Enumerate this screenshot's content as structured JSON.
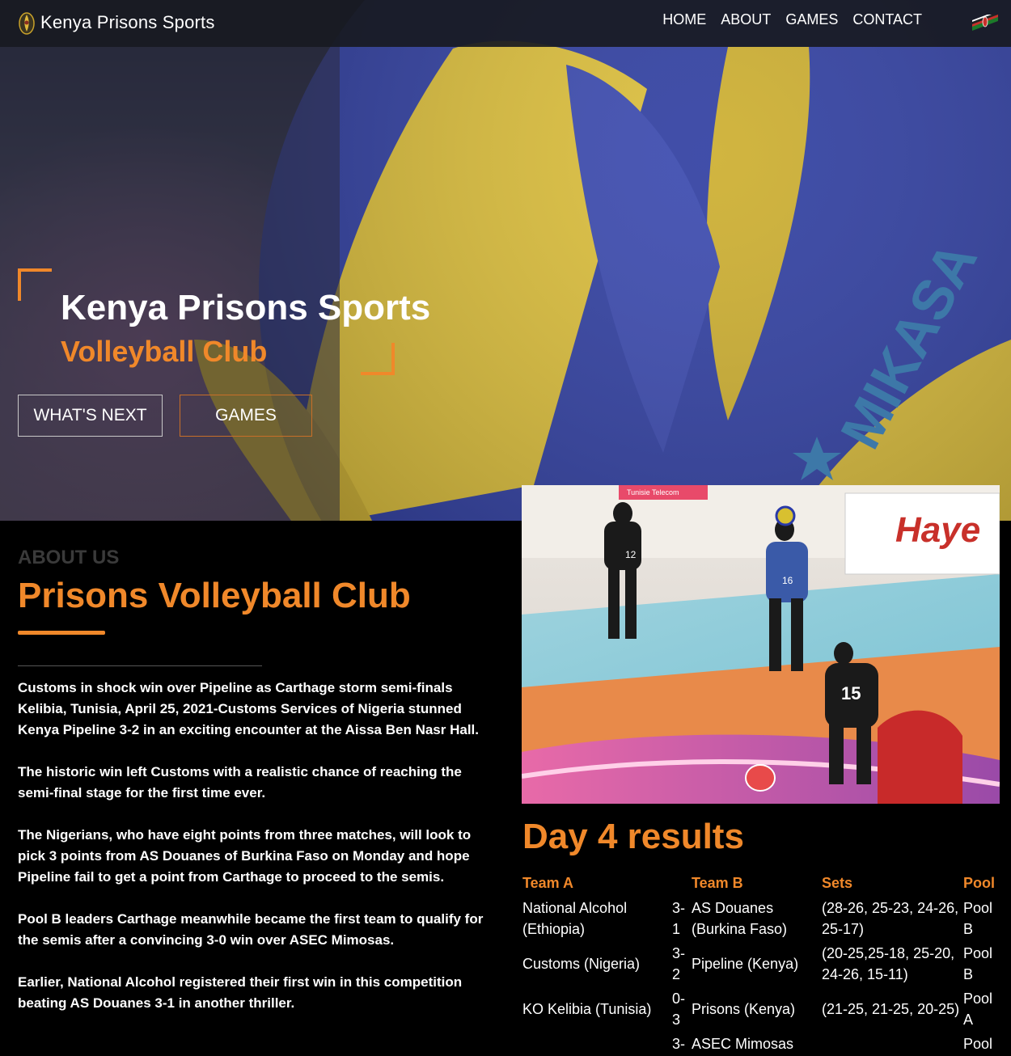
{
  "navbar": {
    "brand": "Kenya Prisons Sports",
    "links": [
      "HOME",
      "ABOUT",
      "GAMES",
      "CONTACT"
    ],
    "logo_icon": "prisons-emblem-icon",
    "flag_icon": "kenya-flag-icon"
  },
  "hero": {
    "title": "Kenya Prisons Sports",
    "subtitle": "Volleyball Club",
    "buttons": [
      "WHAT'S NEXT",
      "GAMES"
    ],
    "ball_brand": "MIKASA"
  },
  "about": {
    "eyebrow": "ABOUT US",
    "heading": "Prisons Volleyball Club",
    "paragraphs": [
      "Customs in shock win over Pipeline as Carthage storm semi-finals Kelibia, Tunisia, April 25, 2021-Customs Services of Nigeria stunned Kenya Pipeline 3-2 in an exciting encounter at the Aissa Ben Nasr Hall.",
      "The historic win left Customs with a realistic chance of reaching the semi-final stage for the first time ever.",
      "The Nigerians, who have eight points from three matches, will look to pick 3 points from AS Douanes of Burkina Faso on Monday and hope Pipeline fail to get a point from Carthage to proceed to the semis.",
      "Pool B leaders Carthage meanwhile became the first team to qualify for the semis after a convincing 3-0 win over ASEC Mimosas.",
      "Earlier, National Alcohol registered their first win in this competition beating AS Douanes 3-1 in another thriller."
    ]
  },
  "photo": {
    "banner_text": "Haye",
    "sponsor_text": "Tunisie Telecom",
    "jersey_numbers": [
      "12",
      "16",
      "15"
    ]
  },
  "results": {
    "heading": "Day 4 results",
    "headers": [
      "Team A",
      "",
      "Team B",
      "Sets",
      "Pool"
    ],
    "rows": [
      [
        "National Alcohol (Ethiopia)",
        "3-1",
        "AS Douanes (Burkina Faso)",
        "(28-26, 25-23, 24-26, 25-17)",
        "Pool B"
      ],
      [
        "Customs (Nigeria)",
        "3-2",
        "Pipeline (Kenya)",
        "(20-25,25-18, 25-20, 24-26, 15-11)",
        "Pool B"
      ],
      [
        "KO Kelibia (Tunisia)",
        "0-3",
        "Prisons (Kenya)",
        "(21-25, 21-25, 20-25)",
        "Pool A"
      ],
      [
        "",
        "3-",
        "ASEC Mimosas",
        "",
        "Pool"
      ]
    ]
  },
  "colors": {
    "accent": "#f0882a",
    "background": "#000000",
    "navbar": "#181a22"
  }
}
